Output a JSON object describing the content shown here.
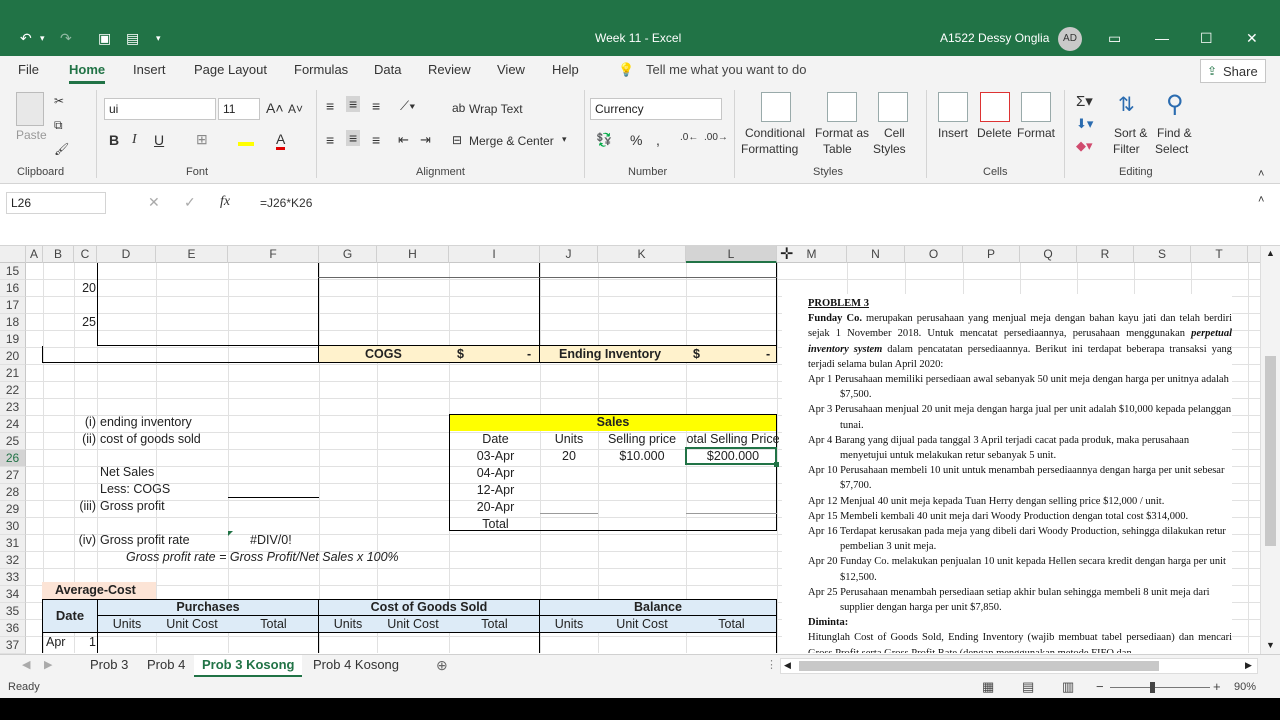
{
  "title_bar": {
    "doc_title": "Week 11  -  Excel",
    "user_name": "A1522 Dessy Onglia",
    "user_initials": "AD"
  },
  "menu": {
    "items": [
      "File",
      "Home",
      "Insert",
      "Page Layout",
      "Formulas",
      "Data",
      "Review",
      "View",
      "Help"
    ],
    "tell_me": "Tell me what you want to do",
    "share": "Share"
  },
  "ribbon": {
    "clipboard": {
      "paste": "Paste",
      "label": "Clipboard"
    },
    "font": {
      "name": "ui",
      "size": "11",
      "label": "Font"
    },
    "alignment": {
      "wrap": "Wrap Text",
      "merge": "Merge & Center",
      "label": "Alignment"
    },
    "number": {
      "format": "Currency",
      "label": "Number"
    },
    "styles": {
      "cond": "Conditional",
      "cond2": "Formatting",
      "fmt_table": "Format as",
      "fmt_table2": "Table",
      "cell_styles": "Cell",
      "cell_styles2": "Styles",
      "label": "Styles"
    },
    "cells": {
      "insert": "Insert",
      "delete": "Delete",
      "format": "Format",
      "label": "Cells"
    },
    "editing": {
      "sort": "Sort &",
      "sort2": "Filter",
      "find": "Find &",
      "find2": "Select",
      "label": "Editing"
    }
  },
  "formula_bar": {
    "name_box": "L26",
    "formula": "=J26*K26"
  },
  "columns": [
    "A",
    "B",
    "C",
    "D",
    "E",
    "F",
    "G",
    "H",
    "I",
    "J",
    "K",
    "L",
    "M",
    "N",
    "O",
    "P",
    "Q",
    "R",
    "S",
    "T"
  ],
  "rows": [
    "15",
    "16",
    "17",
    "18",
    "19",
    "20",
    "21",
    "22",
    "23",
    "24",
    "25",
    "26",
    "27",
    "28",
    "29",
    "30",
    "31",
    "32",
    "33",
    "34",
    "35",
    "36",
    "37"
  ],
  "cells": {
    "c16": "20",
    "c18": "25",
    "cogs": "COGS",
    "cogs_dollar": "$",
    "cogs_val": "-",
    "end_inv": "Ending Inventory",
    "end_dollar": "$",
    "end_val": "-",
    "i_label": "(i)",
    "i_text": "ending inventory",
    "ii_label": "(ii)",
    "ii_text": "cost of goods sold",
    "net_sales": "Net Sales",
    "less_cogs": "Less: COGS",
    "iii_label": "(iii)",
    "iii_text": "Gross profit",
    "iv_label": "(iv)",
    "iv_text": "Gross profit rate",
    "div0": "#DIV/0!",
    "gp_formula": "Gross profit rate = Gross Profit/Net Sales x 100%",
    "avg_cost": "Average-Cost",
    "date": "Date",
    "purchases": "Purchases",
    "cogs_hdr": "Cost of Goods Sold",
    "balance": "Balance",
    "units": "Units",
    "unit_cost": "Unit Cost",
    "total": "Total",
    "apr": "Apr",
    "one": "1"
  },
  "sales_table": {
    "title": "Sales",
    "headers": [
      "Date",
      "Units",
      "Selling price",
      "otal Selling Price"
    ],
    "rows": [
      [
        "03-Apr",
        "20",
        "$10.000",
        "$200.000"
      ],
      [
        "04-Apr",
        "",
        "",
        ""
      ],
      [
        "12-Apr",
        "",
        "",
        ""
      ],
      [
        "20-Apr",
        "",
        "",
        ""
      ],
      [
        "Total",
        "",
        "",
        ""
      ]
    ]
  },
  "problem": {
    "title": "PROBLEM 3",
    "intro_company": "Funday Co.",
    "intro": " merupakan perusahaan yang menjual meja dengan bahan kayu jati dan telah berdiri sejak 1 November 2018. Untuk mencatat persediaannya, perusahaan menggunakan ",
    "intro_italic": "perpetual inventory system",
    "intro_end": " dalam pencatatan persediaannya. Berikut ini terdapat beberapa transaksi yang terjadi selama bulan April 2020:",
    "transactions": [
      "Apr 1  Perusahaan memiliki persediaan awal sebanyak 50 unit meja dengan harga per unitnya adalah $7,500.",
      "Apr 3  Perusahaan menjual 20 unit meja dengan harga jual per unit adalah $10,000 kepada pelanggan tunai.",
      "Apr 4  Barang yang dijual pada tanggal 3 April terjadi cacat pada produk, maka perusahaan menyetujui untuk melakukan retur sebanyak 5 unit.",
      "Apr 10 Perusahaan membeli 10 unit untuk menambah persediaannya dengan harga per unit sebesar $7,700.",
      "Apr 12 Menjual 40 unit meja kepada Tuan Herry dengan selling price $12,000 / unit.",
      "Apr 15 Membeli kembali 40 unit meja dari Woody Production dengan total cost $314,000.",
      "Apr 16 Terdapat kerusakan pada meja yang dibeli dari Woody Production, sehingga dilakukan retur pembelian 3 unit meja.",
      "Apr 20 Funday Co. melakukan penjualan 10 unit kepada Hellen secara kredit dengan harga per unit $12,500.",
      "Apr 25 Perusahaan menambah persediaan setiap akhir bulan sehingga membeli 8 unit meja dari supplier dengan harga per unit $7,850."
    ],
    "diminta": "Diminta:",
    "task": "Hitunglah Cost of Goods Sold, Ending Inventory (wajib membuat tabel persediaan) dan mencari Gross Profit serta Gross Profit Rate (dengan menggunakan metode FIFO dan"
  },
  "sheet_tabs": [
    "Prob 3",
    "Prob 4",
    "Prob 3 Kosong",
    "Prob 4 Kosong"
  ],
  "active_tab": "Prob 3 Kosong",
  "status": {
    "ready": "Ready",
    "zoom": "90%"
  },
  "colors": {
    "excel_green": "#217346",
    "highlight_yellow": "#ffff00",
    "header_blue": "#ddebf7",
    "orange": "#fce4d6"
  }
}
